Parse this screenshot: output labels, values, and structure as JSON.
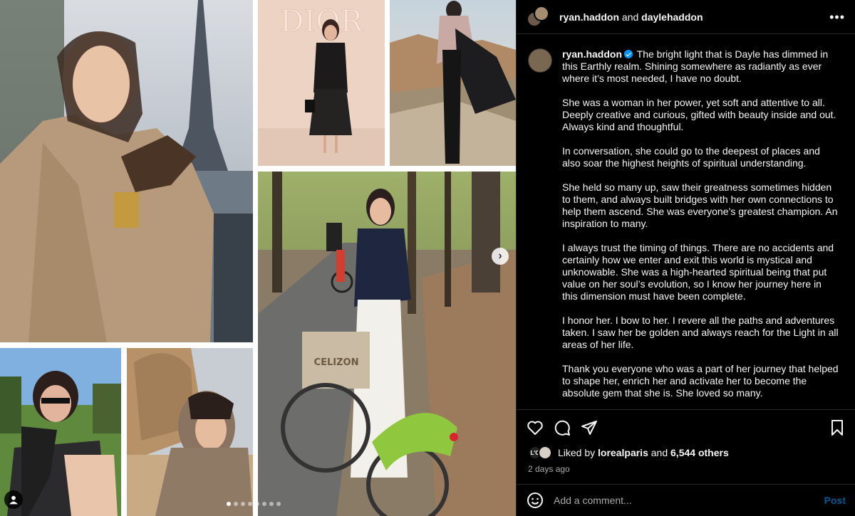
{
  "header": {
    "user1": "ryan.haddon",
    "conjunction": "and",
    "user2": "daylehaddon",
    "more_icon": "more-horizontal-icon"
  },
  "caption": {
    "username": "ryan.haddon",
    "paragraphs": [
      "The bright light that is Dayle has dimmed in this Earthly realm. Shining somewhere as radiantly as ever where it’s most needed, I have no doubt.",
      "She was a woman in her power, yet soft and attentive to all. Deeply creative and curious, gifted with beauty inside and out. Always kind and thoughtful.",
      "In conversation, she could go to the deepest of places and also soar the highest heights of spiritual understanding.",
      "She held so many up, saw their greatness sometimes hidden to them, and always built bridges with her own connections to help them ascend. She was everyone’s greatest champion. An inspiration to many.",
      "I always trust the timing of things. There are no accidents and certainly how we enter and exit this world is mystical and unknowable. She was a high-hearted spiritual being that put value on her soul’s evolution, so I know her journey here in this dimension must have been complete.",
      "I honor her. I bow to her. I revere all the paths and adventures taken. I saw her be golden and always reach for the Light in all areas of her life.",
      "Thank you everyone who was a part of her journey that helped to shape her, enrich her and activate her to become the absolute gem that she is. She loved so many."
    ]
  },
  "media": {
    "dior_sign": "DIOR",
    "bag_text": "CELIZON",
    "carousel_dots": 8,
    "active_dot": 0,
    "next_icon": "chevron-right-icon",
    "tag_icon": "user-tag-icon"
  },
  "likes": {
    "prefix": "Liked by",
    "liker": "lorealparis",
    "conjunction": "and",
    "others": "6,544 others",
    "avatar_label": "L'O"
  },
  "timestamp": "2 days ago",
  "comment": {
    "placeholder": "Add a comment...",
    "post_label": "Post"
  }
}
